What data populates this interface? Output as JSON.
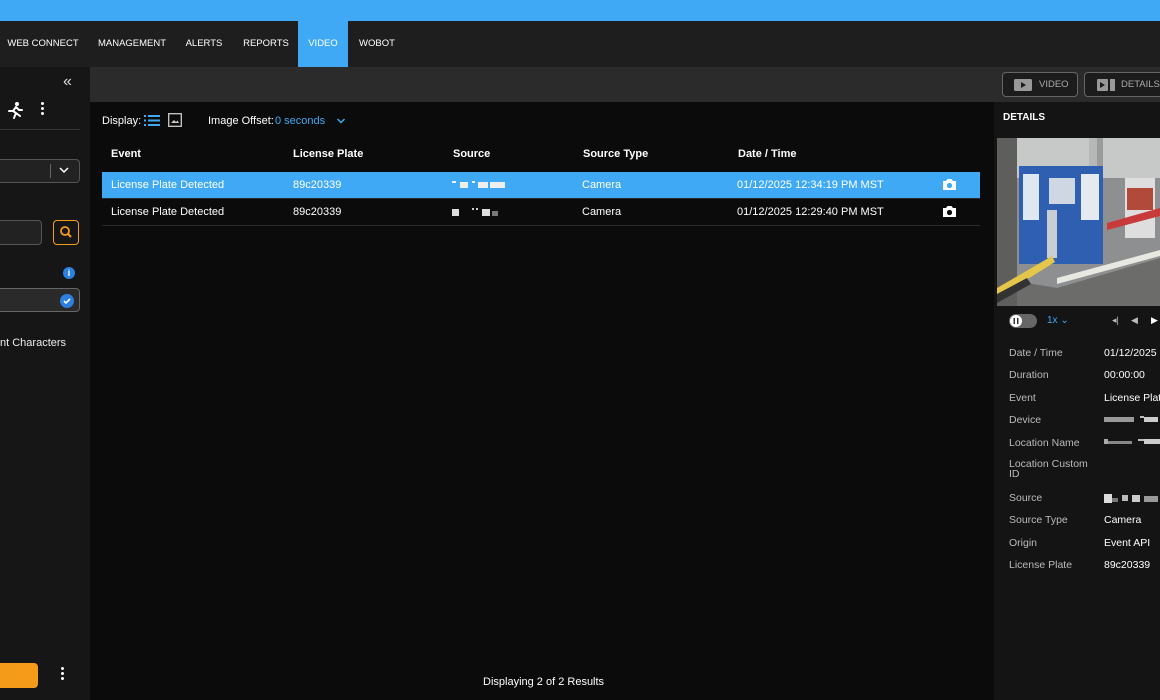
{
  "nav": {
    "items": [
      {
        "label": "WEB CONNECT",
        "active": false
      },
      {
        "label": "MANAGEMENT",
        "active": false
      },
      {
        "label": "ALERTS",
        "active": false
      },
      {
        "label": "REPORTS",
        "active": false
      },
      {
        "label": "VIDEO",
        "active": true
      },
      {
        "label": "WOBOT",
        "active": false
      }
    ]
  },
  "sidebar": {
    "collapse_icon": "double-chevron-left-icon",
    "truncated_text": "nt Characters"
  },
  "toolbar": {
    "display_label": "Display:",
    "image_offset_label": "Image Offset:",
    "image_offset_value": "0 seconds"
  },
  "table": {
    "headers": {
      "event": "Event",
      "license_plate": "License Plate",
      "source": "Source",
      "source_type": "Source Type",
      "date_time": "Date / Time"
    },
    "rows": [
      {
        "event": "License Plate Detected",
        "license_plate": "89c20339",
        "source_type": "Camera",
        "date_time": "01/12/2025 12:34:19 PM MST",
        "selected": true
      },
      {
        "event": "License Plate Detected",
        "license_plate": "89c20339",
        "source_type": "Camera",
        "date_time": "01/12/2025 12:29:40 PM MST",
        "selected": false
      }
    ],
    "footer": "Displaying 2 of 2 Results"
  },
  "right": {
    "video_button": "VIDEO",
    "details_button": "DETAILS",
    "title": "DETAILS",
    "speed": "1x",
    "details": [
      {
        "label": "Date / Time",
        "value": "01/12/2025"
      },
      {
        "label": "Duration",
        "value": "00:00:00"
      },
      {
        "label": "Event",
        "value": "License Plat"
      },
      {
        "label": "Device",
        "value": ""
      },
      {
        "label": "Location Name",
        "value": ""
      },
      {
        "label": "Location Custom ID",
        "value": ""
      },
      {
        "label": "Source",
        "value": ""
      },
      {
        "label": "Source Type",
        "value": "Camera"
      },
      {
        "label": "Origin",
        "value": "Event API"
      },
      {
        "label": "License Plate",
        "value": "89c20339"
      }
    ]
  },
  "colors": {
    "accent": "#3fa9f5",
    "orange": "#f59b1a",
    "background": "#0b0b0b"
  }
}
